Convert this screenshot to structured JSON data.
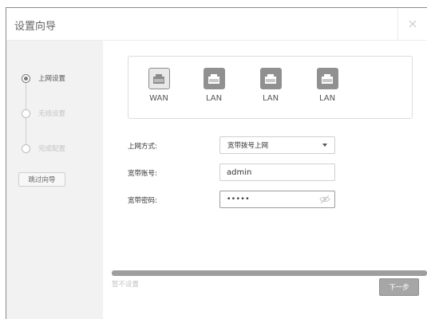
{
  "dialog": {
    "title": "设置向导"
  },
  "steps": [
    {
      "label": "上网设置",
      "state": "active"
    },
    {
      "label": "无线设置",
      "state": "inactive"
    },
    {
      "label": "完成配置",
      "state": "inactive"
    }
  ],
  "skip_label": "跳过向导",
  "ports": [
    {
      "label": "WAN",
      "type": "wan"
    },
    {
      "label": "LAN",
      "type": "lan"
    },
    {
      "label": "LAN",
      "type": "lan"
    },
    {
      "label": "LAN",
      "type": "lan"
    }
  ],
  "form": {
    "connection_type": {
      "label": "上网方式:",
      "value": "宽带拨号上网"
    },
    "account": {
      "label": "宽带账号:",
      "value": "admin"
    },
    "password": {
      "label": "宽带密码:",
      "value": "•••••"
    }
  },
  "footer": {
    "not_now": "暂不设置",
    "next": "下一步"
  },
  "icons": {
    "close": "close-icon",
    "port": "ethernet-port-icon",
    "eye": "eye-slash-icon",
    "dropdown": "chevron-down-icon"
  }
}
